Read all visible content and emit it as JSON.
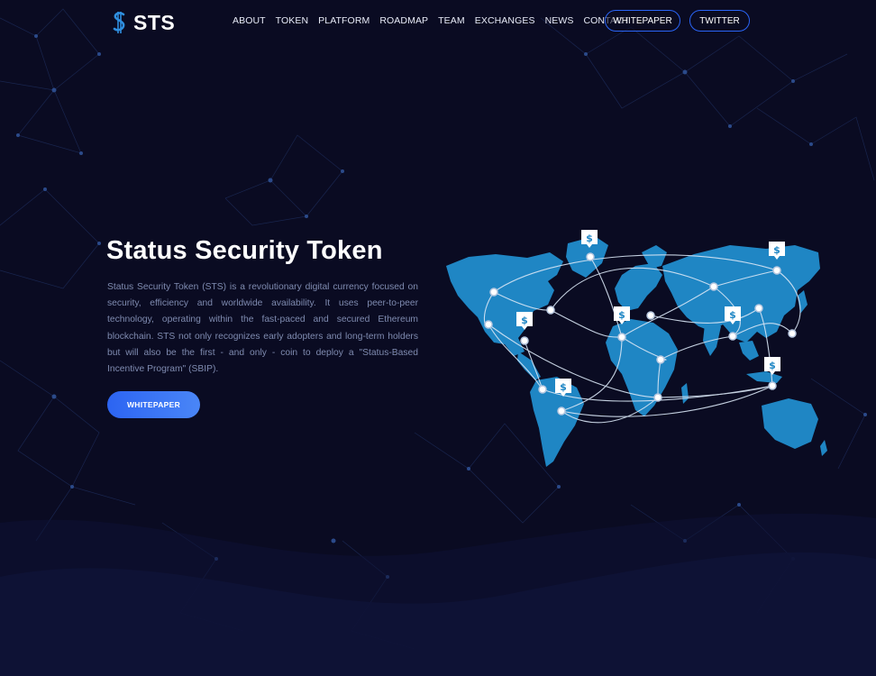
{
  "brand": {
    "name": "STS"
  },
  "nav": {
    "items": [
      {
        "label": "ABOUT"
      },
      {
        "label": "TOKEN"
      },
      {
        "label": "PLATFORM"
      },
      {
        "label": "ROADMAP"
      },
      {
        "label": "TEAM"
      },
      {
        "label": "EXCHANGES"
      },
      {
        "label": "NEWS"
      },
      {
        "label": "CONTACT"
      }
    ],
    "whitepaper_label": "WHITEPAPER",
    "twitter_label": "TWITTER"
  },
  "hero": {
    "title": "Status Security Token",
    "description": "Status Security Token (STS) is a revolutionary digital currency focused on security, efficiency and worldwide availability. It uses peer-to-peer technology, operating within the fast-paced and secured Ethereum blockchain. STS not only recognizes early adopters and long-term holders but will also be the first - and only - coin to deploy a \"Status-Based Incentive Program\" (SBIP).",
    "button_label": "WHITEPAPER"
  },
  "colors": {
    "background": "#0a0b22",
    "accent": "#2a64f5",
    "map_land": "#1f86c4",
    "body_text": "#7f8bb0"
  },
  "map": {
    "marker_icon": "sts-coin-icon",
    "node_icon": "network-node-icon"
  }
}
